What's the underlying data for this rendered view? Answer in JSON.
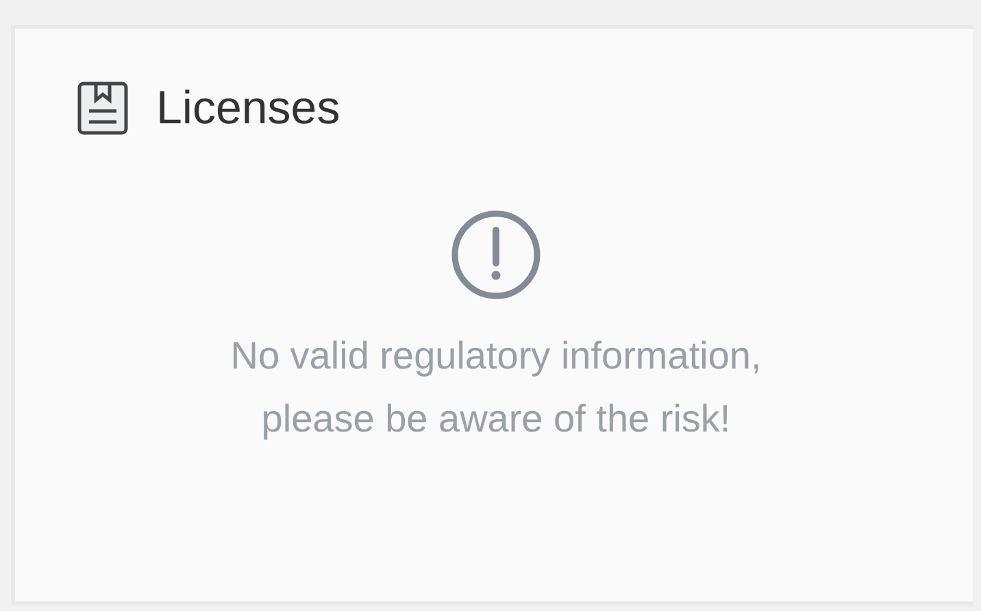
{
  "panel": {
    "title": "Licenses"
  },
  "notice": {
    "lines": [
      "No valid regulatory information,",
      "please be aware of the risk!"
    ]
  }
}
